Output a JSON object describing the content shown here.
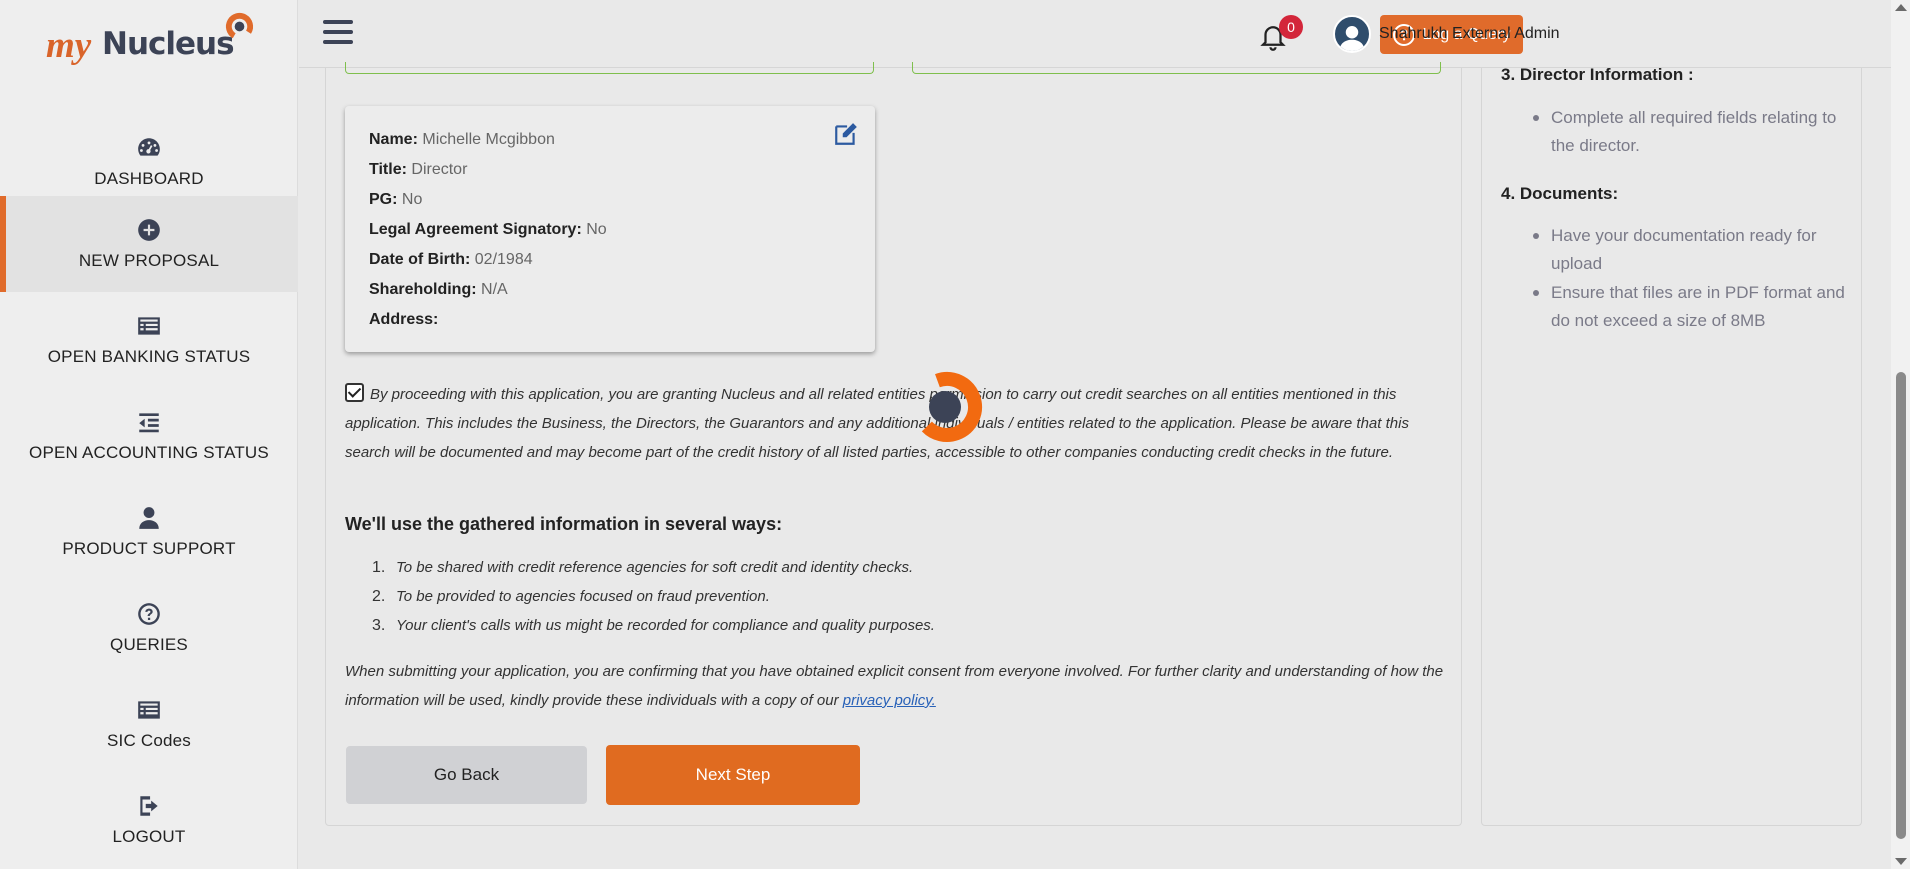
{
  "brand": {
    "prefix": "my",
    "name": "Nucleus"
  },
  "sidebar": {
    "items": [
      {
        "label": "DASHBOARD",
        "icon": "dashboard-gauge-icon"
      },
      {
        "label": "NEW PROPOSAL",
        "icon": "plus-circle-icon",
        "active": true
      },
      {
        "label": "OPEN BANKING STATUS",
        "icon": "list-card-icon"
      },
      {
        "label": "OPEN ACCOUNTING STATUS",
        "icon": "indent-list-icon"
      },
      {
        "label": "PRODUCT SUPPORT",
        "icon": "user-icon"
      },
      {
        "label": "QUERIES",
        "icon": "question-circle-icon"
      },
      {
        "label": "SIC Codes",
        "icon": "list-card-icon"
      },
      {
        "label": "LOGOUT",
        "icon": "logout-icon"
      }
    ]
  },
  "header": {
    "log_query_label": "Log a Query",
    "notification_count": "0",
    "user_name": "Shahrukh External Admin"
  },
  "director": {
    "fields": [
      {
        "key": "Name:",
        "value": "Michelle Mcgibbon"
      },
      {
        "key": "Title:",
        "value": "Director"
      },
      {
        "key": "PG:",
        "value": "No"
      },
      {
        "key": "Legal Agreement Signatory:",
        "value": "No"
      },
      {
        "key": "Date of Birth:",
        "value": "02/1984"
      },
      {
        "key": "Shareholding:",
        "value": "N/A"
      },
      {
        "key": "Address:",
        "value": ""
      }
    ]
  },
  "consent": {
    "checked": true,
    "text": "By proceeding with this application, you are granting Nucleus and all related entities permission to carry out credit searches on all entities mentioned in this application. This includes the Business, the Directors, the Guarantors and any additional individuals / entities related to the application. Please be aware that this search will be documented and may become part of the credit history of all listed parties, accessible to other companies conducting credit checks in the future."
  },
  "usage": {
    "heading": "We'll use the gathered information in several ways:",
    "items": [
      {
        "n": "1.",
        "text": "To be shared with credit reference agencies for soft credit and identity checks."
      },
      {
        "n": "2.",
        "text": "To be provided to agencies focused on fraud prevention."
      },
      {
        "n": "3.",
        "text": "Your client's calls with us might be recorded for compliance and quality purposes."
      }
    ]
  },
  "submit_note": {
    "text": "When submitting your application, you are confirming that you have obtained explicit consent from everyone involved. For further clarity and understanding of how the information will be used, kindly provide these individuals with a copy of our ",
    "link": "privacy policy."
  },
  "actions": {
    "back_label": "Go Back",
    "next_label": "Next Step"
  },
  "info": {
    "sections": [
      {
        "heading": "3. Director Information :",
        "bullets": [
          "Complete all required fields relating to the director."
        ]
      },
      {
        "heading": "4. Documents:",
        "bullets": [
          "Have your documentation ready for upload",
          "Ensure that files are in PDF format and do not exceed a size of 8MB"
        ]
      }
    ]
  },
  "colors": {
    "accent": "#e06b2b",
    "navy": "#3c4356",
    "badge": "#d3263a",
    "link": "#2861b8"
  }
}
